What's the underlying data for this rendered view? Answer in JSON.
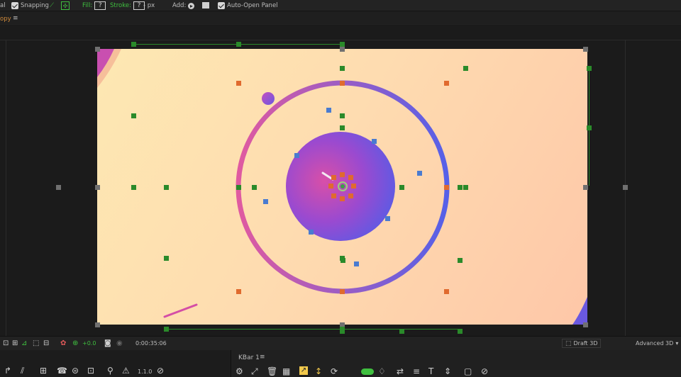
{
  "toolbar": {
    "cut_label": "al",
    "snapping_label": "Snapping",
    "fill_label": "Fill:",
    "fill_value": "?",
    "stroke_label": "Stroke:",
    "stroke_value": "?",
    "px_label": "- px",
    "add_label": "Add:",
    "auto_open_label": "Auto-Open Panel"
  },
  "panelbar": {
    "tab_label": "opy",
    "menu_glyph": "≡"
  },
  "bottom": {
    "exposure": "+0.0",
    "timecode": "0:00:35:06",
    "renderer_label": "Draft 3D",
    "mode_label": "Advanced 3D"
  },
  "kbar": {
    "title": "KBar 1",
    "menu_glyph": "≡",
    "version_label": "1.1.0"
  },
  "colors": {
    "ring_start": "#e05aa0",
    "ring_end": "#5560e8",
    "handle_orange": "#e06a2e",
    "handle_green": "#2a8a2a",
    "handle_blue": "#4a7bd0"
  }
}
